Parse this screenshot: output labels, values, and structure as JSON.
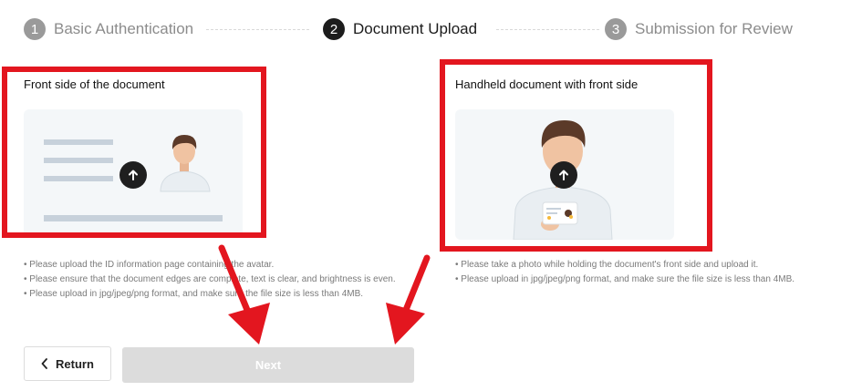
{
  "stepper": {
    "steps": [
      {
        "number": "1",
        "label": "Basic Authentication",
        "state": "inactive"
      },
      {
        "number": "2",
        "label": "Document Upload",
        "state": "active"
      },
      {
        "number": "3",
        "label": "Submission for Review",
        "state": "inactive"
      }
    ]
  },
  "cards": {
    "front": {
      "title": "Front side of the document",
      "notes": [
        "• Please upload the ID information page containing the avatar.",
        "• Please ensure that the document edges are complete, text is clear, and brightness is even.",
        "• Please upload in jpg/jpeg/png format, and make sure the file size is less than 4MB."
      ]
    },
    "handheld": {
      "title": "Handheld document with front side",
      "notes": [
        "• Please take a photo while holding the document's front side and upload it.",
        "• Please upload in jpg/jpeg/png format, and make sure the file size is less than 4MB."
      ]
    }
  },
  "buttons": {
    "return_label": "Return",
    "next_label": "Next"
  },
  "colors": {
    "highlight": "#e3161f",
    "active_step": "#1c1c1c",
    "inactive_step": "#9a9a9a",
    "next_disabled": "#dcdcdc"
  },
  "icons": {
    "upload": "upload-arrow-icon",
    "return": "chevron-left-icon"
  }
}
